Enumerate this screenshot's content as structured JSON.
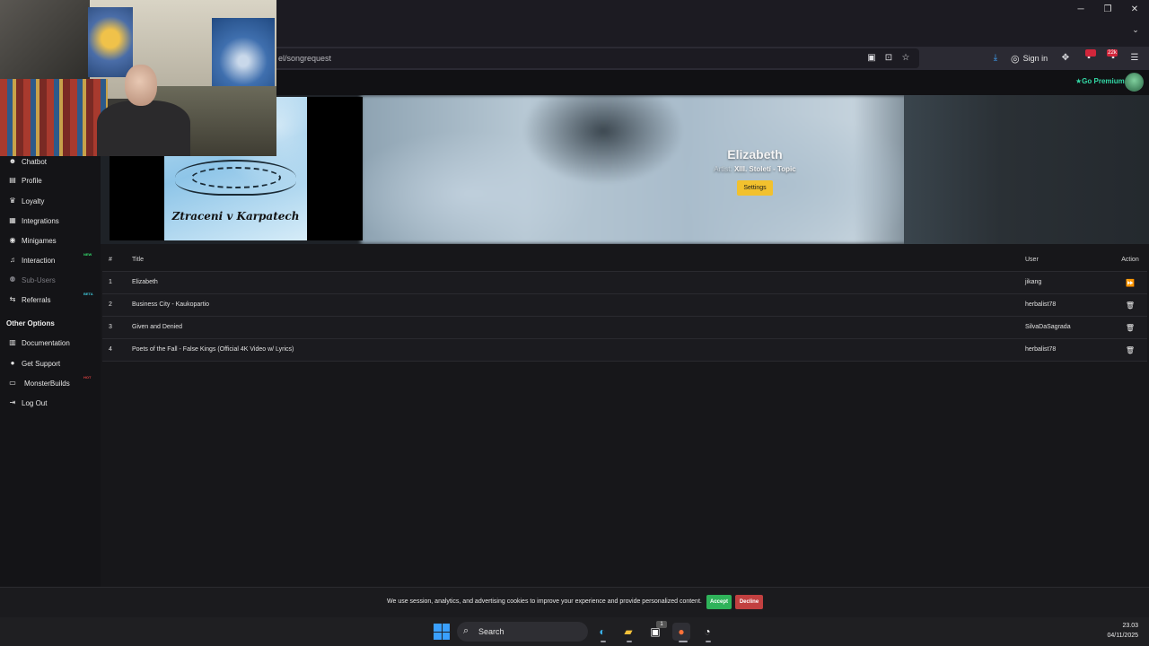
{
  "browser": {
    "url_partial": "el/songrequest",
    "window_controls": {
      "minimize": "─",
      "restore": "❐",
      "close": "✕"
    },
    "tab_list": "⌄",
    "toolbar": {
      "sign_in_label": "Sign in",
      "extension_badge_1": "",
      "extension_badge_2": "22k"
    }
  },
  "site": {
    "premium_label": "Go Premium",
    "sidebar": {
      "items": [
        {
          "label": "Chatbot",
          "icon": "robot-icon",
          "glyph": "☻"
        },
        {
          "label": "Profile",
          "icon": "document-icon",
          "glyph": "▤"
        },
        {
          "label": "Loyalty",
          "icon": "trophy-icon",
          "glyph": "♛"
        },
        {
          "label": "Integrations",
          "icon": "puzzle-icon",
          "glyph": "▦"
        },
        {
          "label": "Minigames",
          "icon": "gamepad-icon",
          "glyph": "◉"
        },
        {
          "label": "Interaction",
          "icon": "music-icon",
          "glyph": "♫",
          "badge": "NEW"
        },
        {
          "label": "Sub-Users",
          "icon": "users-icon",
          "glyph": "⚉",
          "disabled": true
        },
        {
          "label": "Referrals",
          "icon": "share-icon",
          "glyph": "⇆",
          "badge": "BETA"
        }
      ],
      "other_options_heading": "Other Options",
      "other_items": [
        {
          "label": "Documentation",
          "icon": "book-icon",
          "glyph": "▥"
        },
        {
          "label": "Get Support",
          "icon": "support-icon",
          "glyph": "●"
        },
        {
          "label": "MonsterBuilds",
          "icon": "laptop-icon",
          "glyph": "▭",
          "badge": "HOT"
        },
        {
          "label": "Log Out",
          "icon": "logout-icon",
          "glyph": "⇥"
        }
      ]
    },
    "now_playing": {
      "title": "Elizabeth",
      "artist_label": "Artist:",
      "artist": "XIII. Století - Topic",
      "album_art_text": "Ztraceni v Karpatech",
      "settings_label": "Settings"
    },
    "queue": {
      "headers": {
        "num": "#",
        "title": "Title",
        "user": "User",
        "action": "Action"
      },
      "rows": [
        {
          "num": "1",
          "title": "Elizabeth",
          "user": "jikang",
          "action": "⏩"
        },
        {
          "num": "2",
          "title": "Business City - Kaukopartio",
          "user": "herbalist78",
          "action": "🗑"
        },
        {
          "num": "3",
          "title": "Given and Denied",
          "user": "SilvaDaSagrada",
          "action": "🗑"
        },
        {
          "num": "4",
          "title": "Poets of the Fall - False Kings (Official 4K Video w/ Lyrics)",
          "user": "herbalist78",
          "action": "🗑"
        }
      ]
    },
    "cookie": {
      "text": "We use session, analytics, and advertising cookies to improve your experience and provide personalized content.",
      "accept": "Accept",
      "decline": "Decline"
    }
  },
  "taskbar": {
    "search_label": "Search",
    "time": "23.03",
    "date": "04/11/2025",
    "store_badge": "1"
  },
  "colors": {
    "accent_yellow": "#f2c12e",
    "accept_green": "#2fb35a",
    "decline_red": "#c24040",
    "premium_green": "#33d9a6",
    "badge_new": "#33d96b",
    "badge_beta": "#3fc7d9",
    "badge_hot": "#d94040"
  }
}
